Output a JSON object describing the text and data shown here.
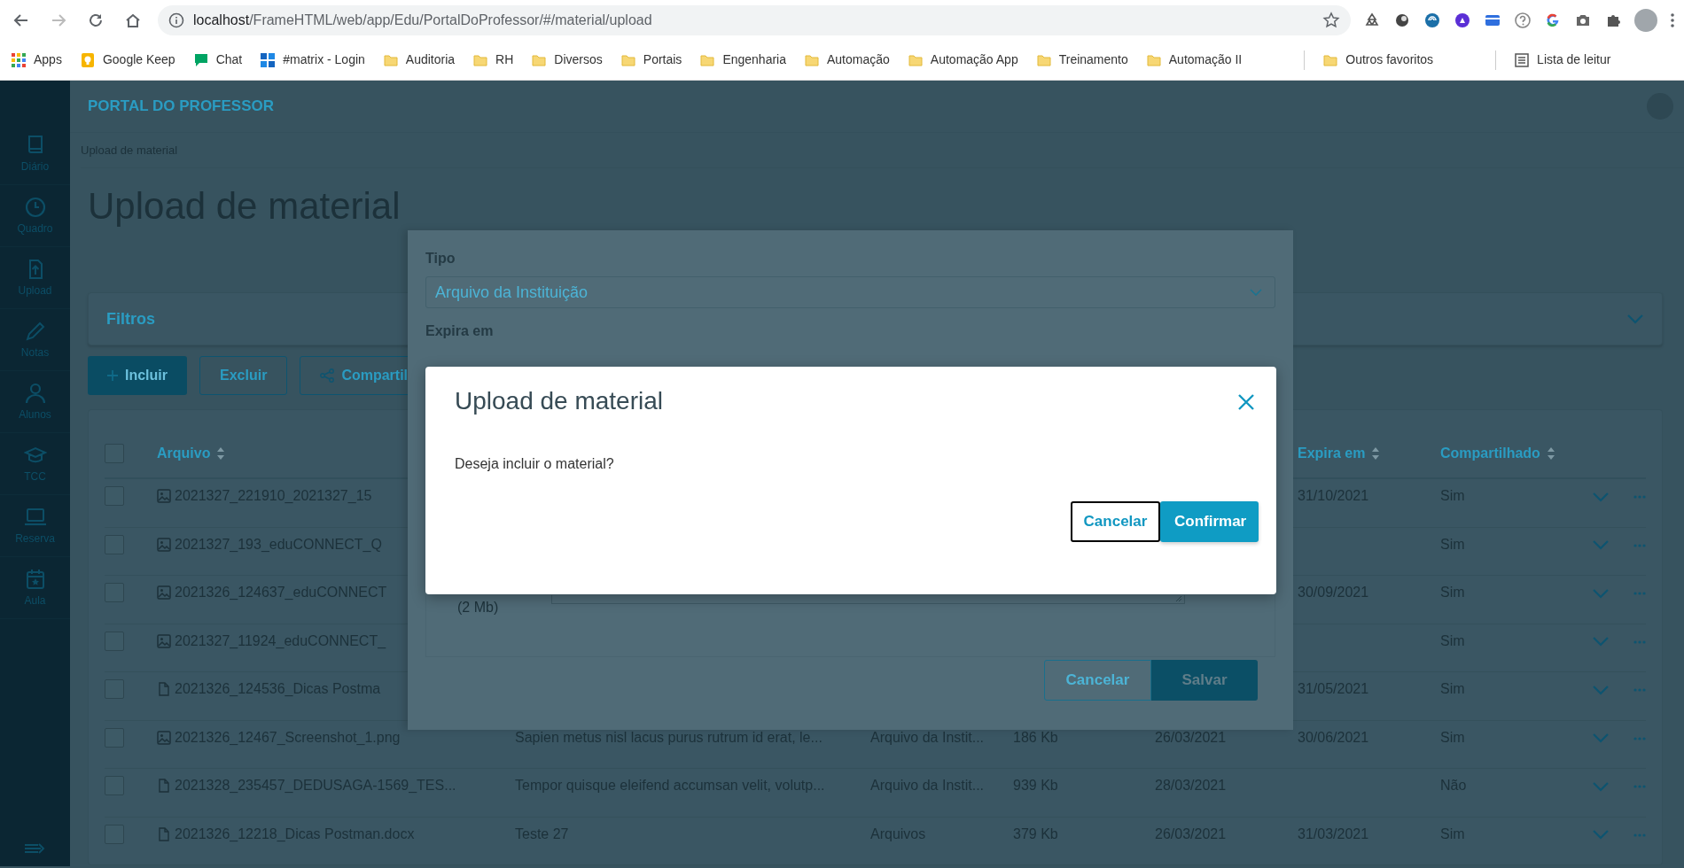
{
  "browser": {
    "url_host": "localhost",
    "url_path": "/FrameHTML/web/app/Edu/PortalDoProfessor/#/material/upload",
    "extensions": [
      {
        "kind": "recycle"
      },
      {
        "kind": "circle"
      },
      {
        "kind": "wave"
      },
      {
        "kind": "blob"
      },
      {
        "kind": "card"
      },
      {
        "kind": "help"
      },
      {
        "kind": "g"
      },
      {
        "kind": "camera"
      },
      {
        "kind": "puzzle"
      }
    ],
    "bookmarks": [
      {
        "label": "Apps",
        "kind": "apps"
      },
      {
        "label": "Google Keep",
        "kind": "keep"
      },
      {
        "label": "Chat",
        "kind": "chat"
      },
      {
        "label": "#matrix - Login",
        "kind": "grid"
      },
      {
        "label": "Auditoria",
        "kind": "folder"
      },
      {
        "label": "RH",
        "kind": "folder"
      },
      {
        "label": "Diversos",
        "kind": "folder"
      },
      {
        "label": "Portais",
        "kind": "folder"
      },
      {
        "label": "Engenharia",
        "kind": "folder"
      },
      {
        "label": "Automação",
        "kind": "folder"
      },
      {
        "label": "Automação App",
        "kind": "folder"
      },
      {
        "label": "Treinamento",
        "kind": "folder"
      },
      {
        "label": "Automação II",
        "kind": "folder"
      }
    ],
    "other_bookmarks": [
      {
        "label": "Outros favoritos",
        "kind": "folder"
      },
      {
        "label": "Lista de leitur",
        "kind": "reading"
      }
    ]
  },
  "app": {
    "title": "PORTAL DO PROFESSOR",
    "breadcrumb": "Upload de material",
    "heading": "Upload de material"
  },
  "sidebar": {
    "items": [
      {
        "label": "Diário",
        "kind": "book"
      },
      {
        "label": "Quadro",
        "kind": "clock"
      },
      {
        "label": "Upload",
        "kind": "upload"
      },
      {
        "label": "Notas",
        "kind": "pencil"
      },
      {
        "label": "Alunos",
        "kind": "person"
      },
      {
        "label": "TCC",
        "kind": "cap"
      },
      {
        "label": "Reserva",
        "kind": "laptop"
      },
      {
        "label": "Aula",
        "kind": "calendar"
      }
    ]
  },
  "filters": {
    "title": "Filtros"
  },
  "toolbar": [
    {
      "label": "Incluir",
      "kind": "primary"
    },
    {
      "label": "Excluir",
      "kind": "outline"
    },
    {
      "label": "Compartil",
      "kind": "share"
    }
  ],
  "table": {
    "all_checked": false,
    "columns": [
      {
        "kind": "file",
        "label": "Arquivo"
      },
      {
        "kind": "expires",
        "label": "Expira em"
      },
      {
        "kind": "shared",
        "label": "Compartilhado"
      }
    ],
    "rows": [
      {
        "checked": false,
        "kind": "image",
        "file": "2021327_221910_2021327_15",
        "expires": "31/10/2021",
        "shared": "Sim"
      },
      {
        "checked": false,
        "kind": "image",
        "file": "2021327_193_eduCONNECT_Q",
        "shared": "Sim"
      },
      {
        "checked": false,
        "kind": "image",
        "file": "2021326_124637_eduCONNECT",
        "expires": "30/09/2021",
        "shared": "Sim"
      },
      {
        "checked": false,
        "kind": "image",
        "file": "2021327_11924_eduCONNECT_",
        "shared": "Sim"
      },
      {
        "checked": false,
        "kind": "document",
        "file": "2021326_124536_Dicas Postma",
        "expires": "31/05/2021",
        "shared": "Sim"
      },
      {
        "checked": false,
        "kind": "image",
        "file": "2021326_12467_Screenshot_1.png",
        "description": "Sapien metus nisl lacus purus rutrum id erat, le...",
        "type": "Arquivo da Instit...",
        "size": "186 Kb",
        "date": "26/03/2021",
        "expires": "30/06/2021",
        "shared": "Sim"
      },
      {
        "checked": false,
        "kind": "document",
        "file": "2021328_235457_DEDUSAGA-1569_TES...",
        "description": "Tempor quisque eleifend accumsan velit, volutp...",
        "type": "Arquivo da Instit...",
        "size": "939 Kb",
        "date": "28/03/2021",
        "shared": "Não"
      },
      {
        "checked": false,
        "kind": "document",
        "file": "2021326_12218_Dicas Postman.docx",
        "description": "Teste 27",
        "type": "Arquivos",
        "size": "379 Kb",
        "date": "26/03/2021",
        "expires": "31/03/2021",
        "shared": "Sim"
      }
    ]
  },
  "drawer": {
    "type_label": "Tipo",
    "type_value": "Arquivo da Instituição",
    "expires_label": "Expira em",
    "size_note": "(2 Mb)",
    "buttons": [
      {
        "label": "Cancelar",
        "kind": "outline"
      },
      {
        "label": "Salvar",
        "kind": "primary"
      }
    ]
  },
  "modal": {
    "title": "Upload de material",
    "message": "Deseja incluir o material?",
    "buttons": [
      {
        "label": "Cancelar",
        "kind": "outline"
      },
      {
        "label": "Confirmar",
        "kind": "primary"
      }
    ]
  }
}
